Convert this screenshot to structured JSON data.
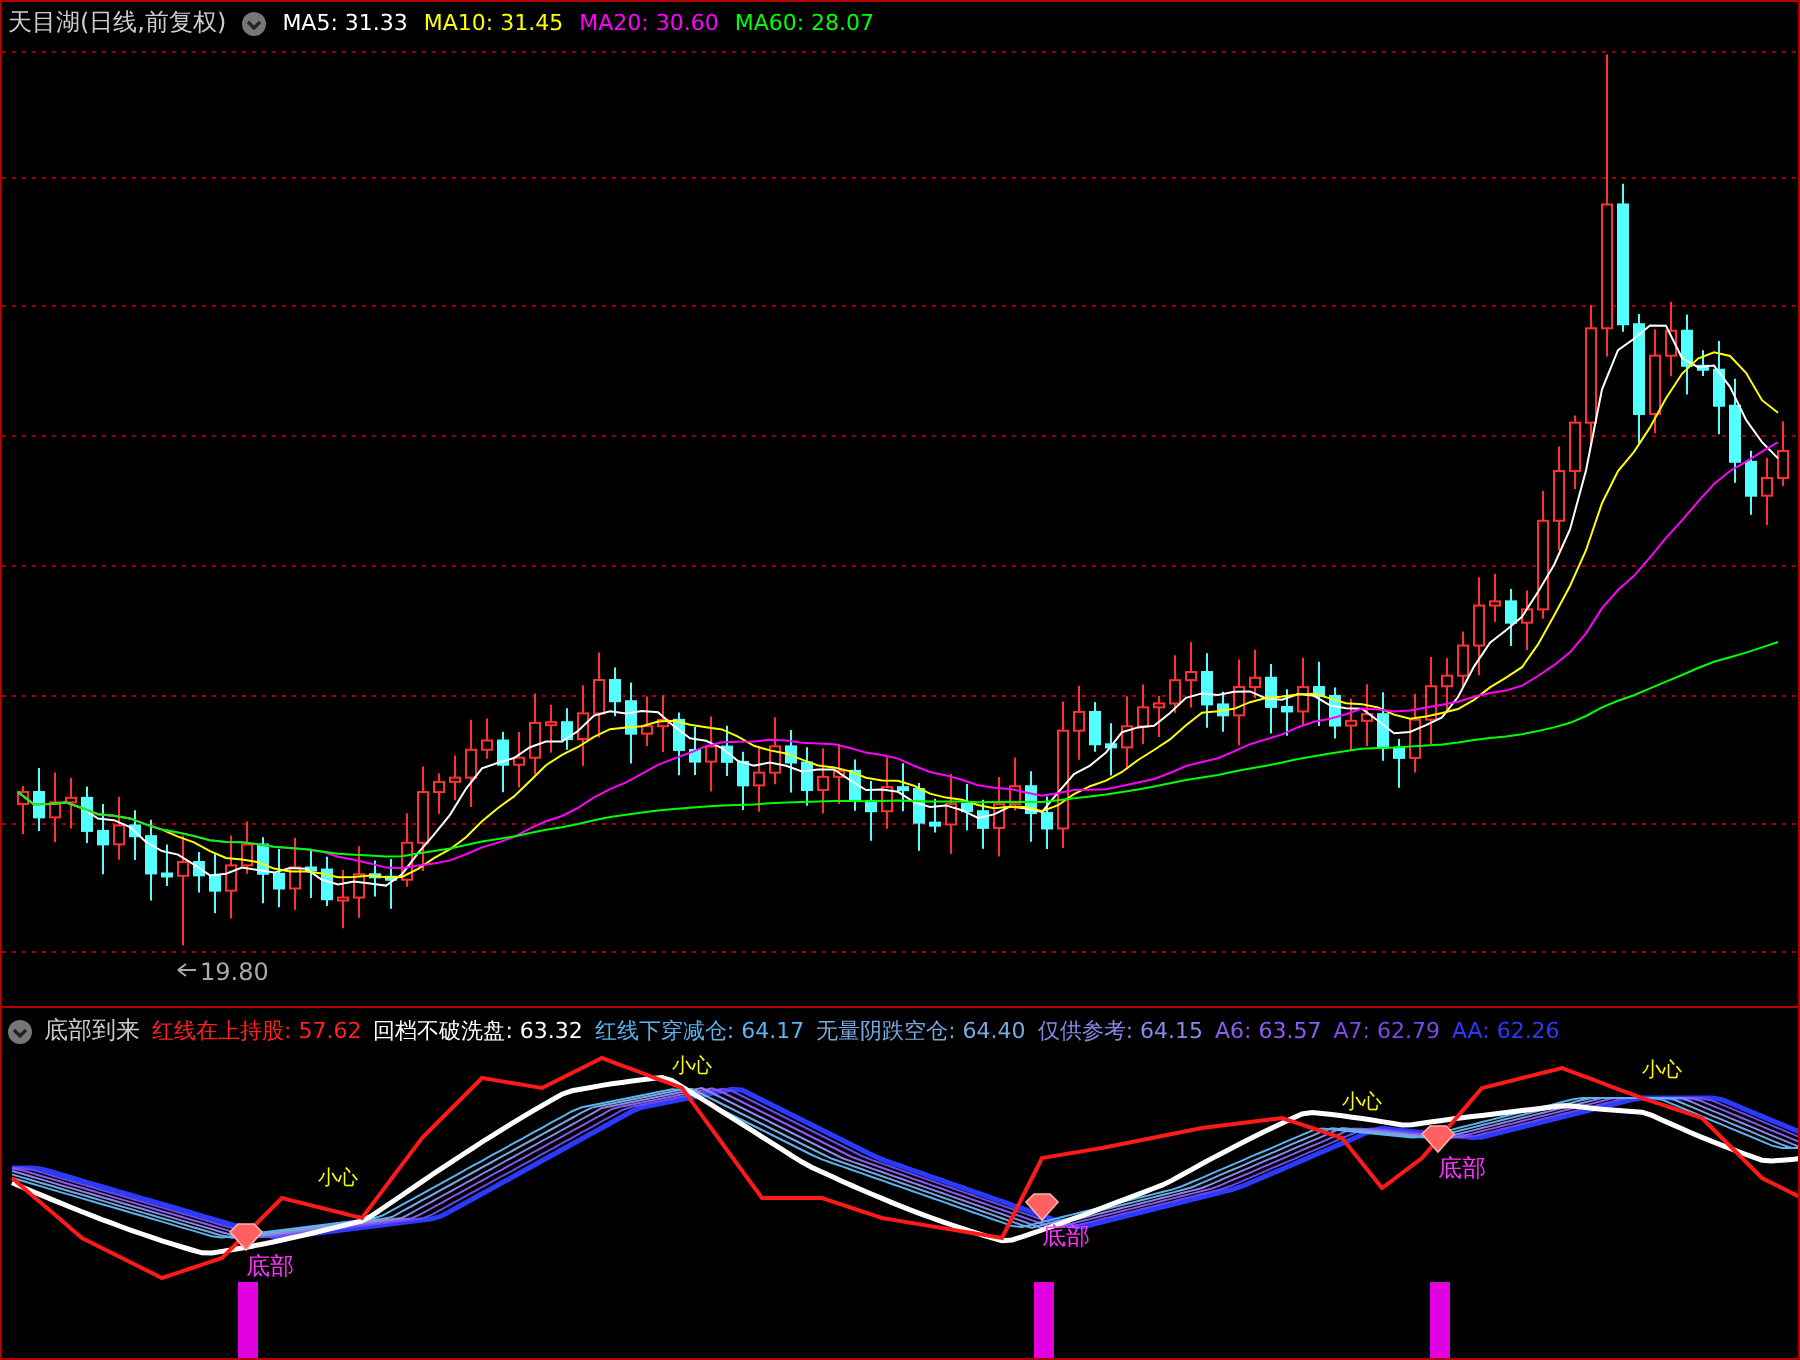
{
  "main_panel": {
    "title": "天目湖(日线,前复权)",
    "indicators": [
      {
        "label": "MA5: 31.33",
        "color": "#ffffff"
      },
      {
        "label": "MA10: 31.45",
        "color": "#ffff00"
      },
      {
        "label": "MA20: 30.60",
        "color": "#ff00ff"
      },
      {
        "label": "MA60: 28.07",
        "color": "#00ff00"
      }
    ],
    "low_label": "19.80"
  },
  "indicator_panel": {
    "title": "底部到来",
    "indicators": [
      {
        "label": "红线在上持股: 57.62",
        "color": "#ff2020"
      },
      {
        "label": "回档不破洗盘: 63.32",
        "color": "#ffffff"
      },
      {
        "label": "红线下穿减仓: 64.17",
        "color": "#5ab4f0"
      },
      {
        "label": "无量阴跌空仓: 64.40",
        "color": "#78a8e0"
      },
      {
        "label": "仅供参考: 64.15",
        "color": "#8a88e8"
      },
      {
        "label": "A6: 63.57",
        "color": "#8a5cf0"
      },
      {
        "label": "A7: 62.79",
        "color": "#7a4ae8"
      },
      {
        "label": "AA: 62.26",
        "color": "#2a3aff"
      }
    ],
    "bottom_labels": [
      "底部",
      "底部",
      "底部"
    ],
    "caution_labels": [
      "小心",
      "小心",
      "小心",
      "小心"
    ]
  }
}
